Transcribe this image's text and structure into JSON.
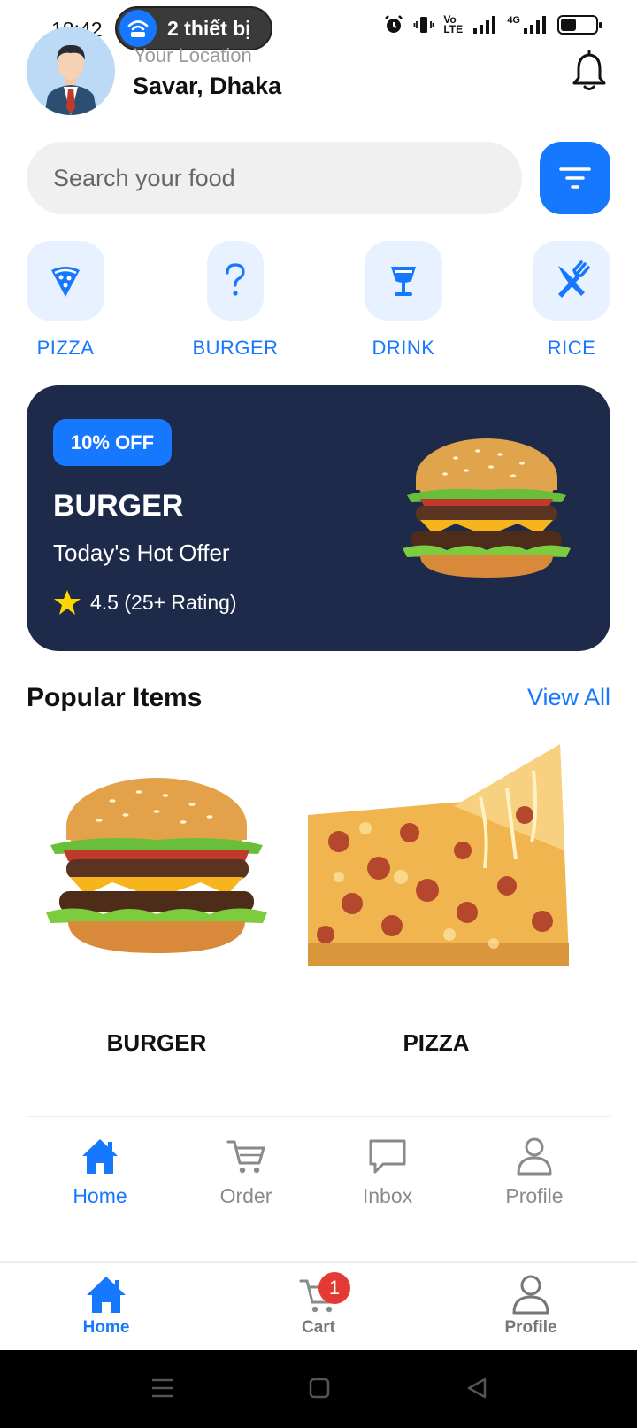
{
  "status_bar": {
    "time": "18:42",
    "hotspot_text": "2 thiết bị",
    "network_label": "Vo LTE",
    "signal_label": "4G",
    "battery_level": 0.45
  },
  "header": {
    "location_label": "Your Location",
    "location_value": "Savar, Dhaka"
  },
  "search": {
    "placeholder": "Search your food"
  },
  "categories": [
    {
      "label": "PIZZA",
      "icon": "pizza-icon"
    },
    {
      "label": "BURGER",
      "icon": "question-icon"
    },
    {
      "label": "DRINK",
      "icon": "drink-icon"
    },
    {
      "label": "RICE",
      "icon": "fork-knife-icon"
    }
  ],
  "offer": {
    "badge": "10% OFF",
    "title": "BURGER",
    "subtitle": "Today's Hot Offer",
    "rating_text": "4.5 (25+ Rating)"
  },
  "popular": {
    "title": "Popular Items",
    "view_all": "View All",
    "items": [
      {
        "name": "BURGER"
      },
      {
        "name": "PIZZA"
      }
    ]
  },
  "app_nav": {
    "items": [
      {
        "label": "Home",
        "active": true
      },
      {
        "label": "Order",
        "active": false
      },
      {
        "label": "Inbox",
        "active": false
      },
      {
        "label": "Profile",
        "active": false
      }
    ]
  },
  "bottom_bar": {
    "items": [
      {
        "label": "Home",
        "active": true
      },
      {
        "label": "Cart",
        "active": false,
        "badge": "1"
      },
      {
        "label": "Profile",
        "active": false
      }
    ]
  },
  "colors": {
    "accent": "#1677ff",
    "banner_bg": "#1e2a4a",
    "tile_bg": "#e8f1ff",
    "badge_red": "#e53935"
  }
}
